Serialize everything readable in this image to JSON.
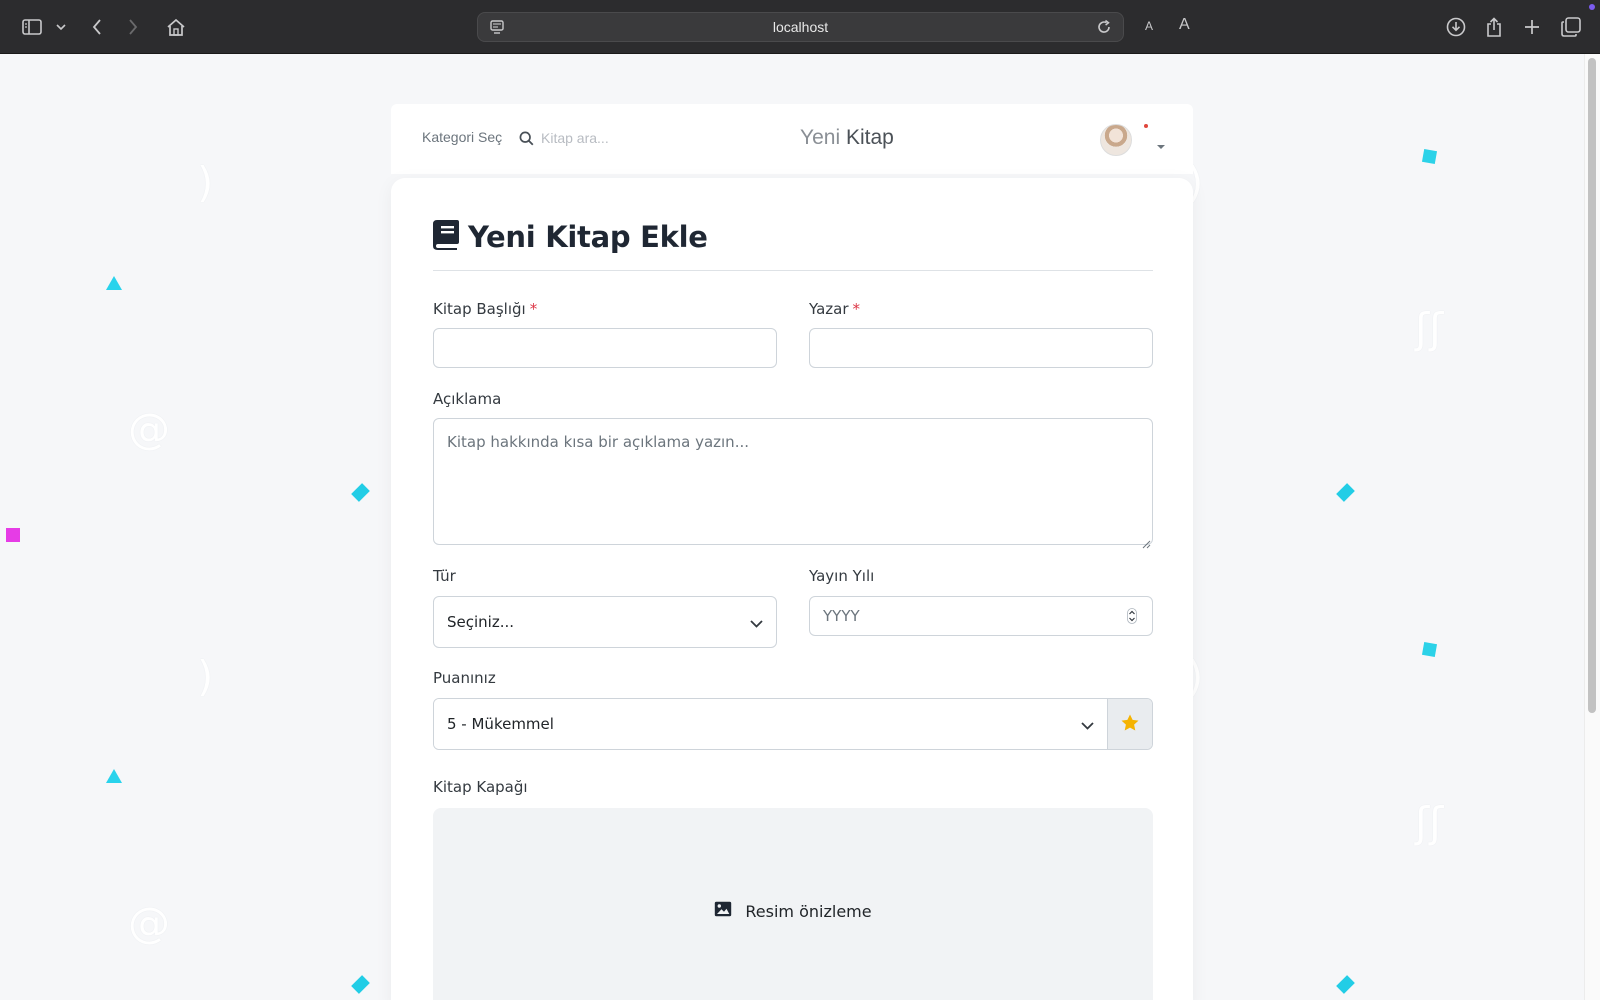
{
  "browser": {
    "url": "localhost",
    "font_small": "A",
    "font_large": "A"
  },
  "header": {
    "category_select": "Kategori Seç",
    "search_placeholder": "Kitap ara...",
    "brand_part1": "Yeni",
    "brand_part2": "Kitap"
  },
  "form": {
    "title": "Yeni Kitap Ekle",
    "title_label": "Kitap Başlığı",
    "author_label": "Yazar",
    "required_mark": "*",
    "description_label": "Açıklama",
    "description_placeholder": "Kitap hakkında kısa bir açıklama yazın...",
    "genre_label": "Tür",
    "genre_value": "Seçiniz...",
    "year_label": "Yayın Yılı",
    "year_placeholder": "YYYY",
    "rating_label": "Puanınız",
    "rating_value": "5 - Mükemmel",
    "cover_label": "Kitap Kapağı",
    "preview_text": "Resim önizleme"
  },
  "colors": {
    "accent_star": "#f5b301",
    "required": "#dc3545",
    "deco_cyan": "#29d3ec",
    "deco_magenta": "#e63ce6"
  }
}
